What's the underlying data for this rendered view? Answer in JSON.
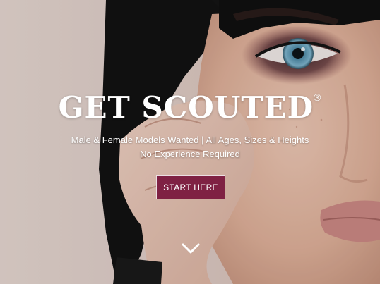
{
  "hero": {
    "title": "GET SCOUTED",
    "trademark": "®",
    "subtitle_line1": "Male & Female Models Wanted | All Ages, Sizes & Heights",
    "subtitle_line2": "No Experience Required",
    "cta_label": "START HERE",
    "scroll_icon": "chevron-down-icon"
  },
  "colors": {
    "cta_background": "#7f2143",
    "text": "#ffffff"
  }
}
